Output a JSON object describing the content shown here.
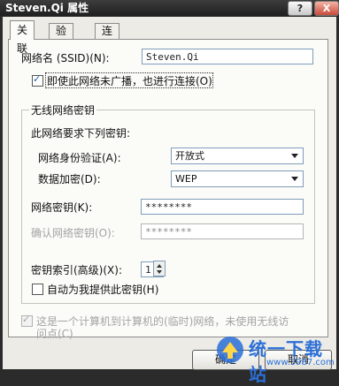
{
  "window": {
    "title": "Steven.Qi 属性",
    "help_glyph": "?",
    "close_glyph": "X"
  },
  "tabs": [
    {
      "label": "关联",
      "active": true
    },
    {
      "label": "验证",
      "active": false
    },
    {
      "label": "连接",
      "active": false
    }
  ],
  "ssid": {
    "label": "网络名 (SSID)(N):",
    "value": "Steven.Qi"
  },
  "broadcast_check": {
    "label": "即使此网络未广播，也进行连接(O)",
    "checked": true
  },
  "wireless_key": {
    "group_title": "无线网络密钥",
    "requires_label": "此网络要求下列密钥:",
    "auth_label": "网络身份验证(A):",
    "auth_value": "开放式",
    "encryption_label": "数据加密(D):",
    "encryption_value": "WEP",
    "key_label": "网络密钥(K):",
    "key_value": "********",
    "confirm_label": "确认网络密钥(O):",
    "confirm_value": "********",
    "index_label": "密钥索引(高级)(X):",
    "index_value": "1",
    "auto_key_label": "自动为我提供此密钥(H)",
    "auto_key_checked": false
  },
  "adhoc_check": {
    "label_line1": "这是一个计算机到计算机的(临时)网络，未使用无线访",
    "label_line2": "问点(C)",
    "checked": true,
    "disabled": true
  },
  "buttons": {
    "ok": "确定",
    "cancel": "取消"
  },
  "watermark": {
    "text": "统一下载站",
    "url": "www.3987.com"
  }
}
